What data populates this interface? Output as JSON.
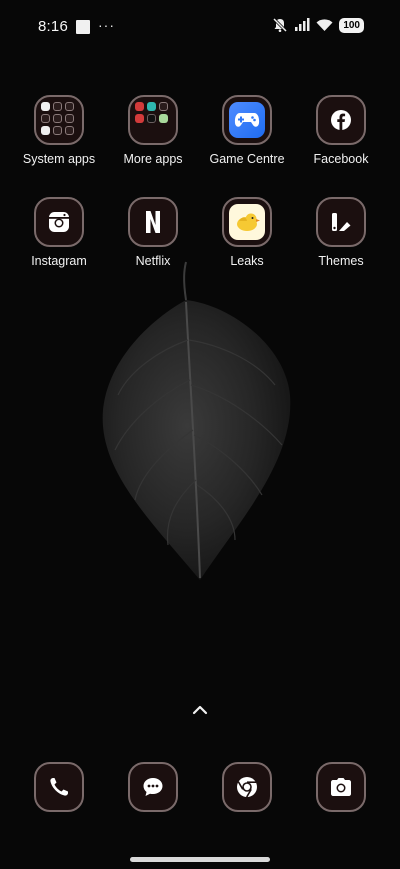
{
  "status_bar": {
    "time": "8:16",
    "notifications_overflow": "···",
    "battery_level": "100",
    "icons": [
      "notification-square-icon",
      "mute-icon",
      "signal-icon",
      "wifi-icon",
      "battery-icon"
    ]
  },
  "apps": [
    {
      "label": "System apps",
      "icon": "folder-icon"
    },
    {
      "label": "More apps",
      "icon": "folder-icon"
    },
    {
      "label": "Game Centre",
      "icon": "gamepad-icon"
    },
    {
      "label": "Facebook",
      "icon": "facebook-icon"
    },
    {
      "label": "Instagram",
      "icon": "instagram-icon"
    },
    {
      "label": "Netflix",
      "icon": "netflix-icon"
    },
    {
      "label": "Leaks",
      "icon": "bird-icon"
    },
    {
      "label": "Themes",
      "icon": "themes-icon"
    }
  ],
  "dock": [
    {
      "name": "Phone",
      "icon": "phone-icon"
    },
    {
      "name": "Messages",
      "icon": "message-icon"
    },
    {
      "name": "Chrome",
      "icon": "chrome-icon"
    },
    {
      "name": "Camera",
      "icon": "camera-icon"
    }
  ],
  "colors": {
    "background": "#070707",
    "icon_tile": "#1b0f0f",
    "icon_border": "#7a6a6a",
    "label_text": "#f1f1f1"
  }
}
